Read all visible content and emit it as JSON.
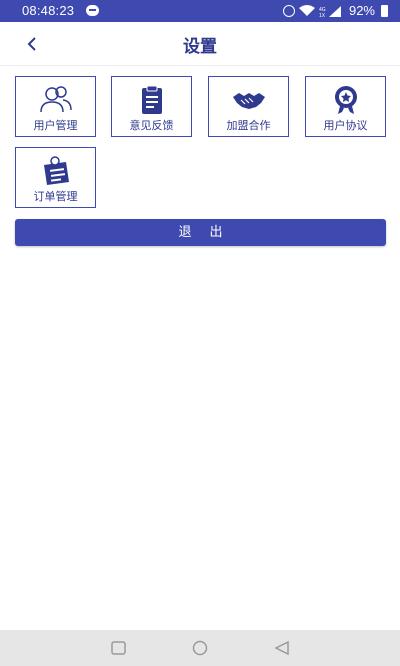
{
  "status_bar": {
    "time": "08:48:23",
    "battery": "92%"
  },
  "header": {
    "title": "设置"
  },
  "tiles": [
    {
      "label": "用户管理",
      "icon": "users-icon"
    },
    {
      "label": "意见反馈",
      "icon": "clipboard-icon"
    },
    {
      "label": "加盟合作",
      "icon": "handshake-icon"
    },
    {
      "label": "用户协议",
      "icon": "award-icon"
    },
    {
      "label": "订单管理",
      "icon": "order-icon"
    }
  ],
  "logout_label": "退出",
  "colors": {
    "primary": "#3e4ab0",
    "text": "#2f3a8f",
    "navbar": "#e6e6e6"
  }
}
